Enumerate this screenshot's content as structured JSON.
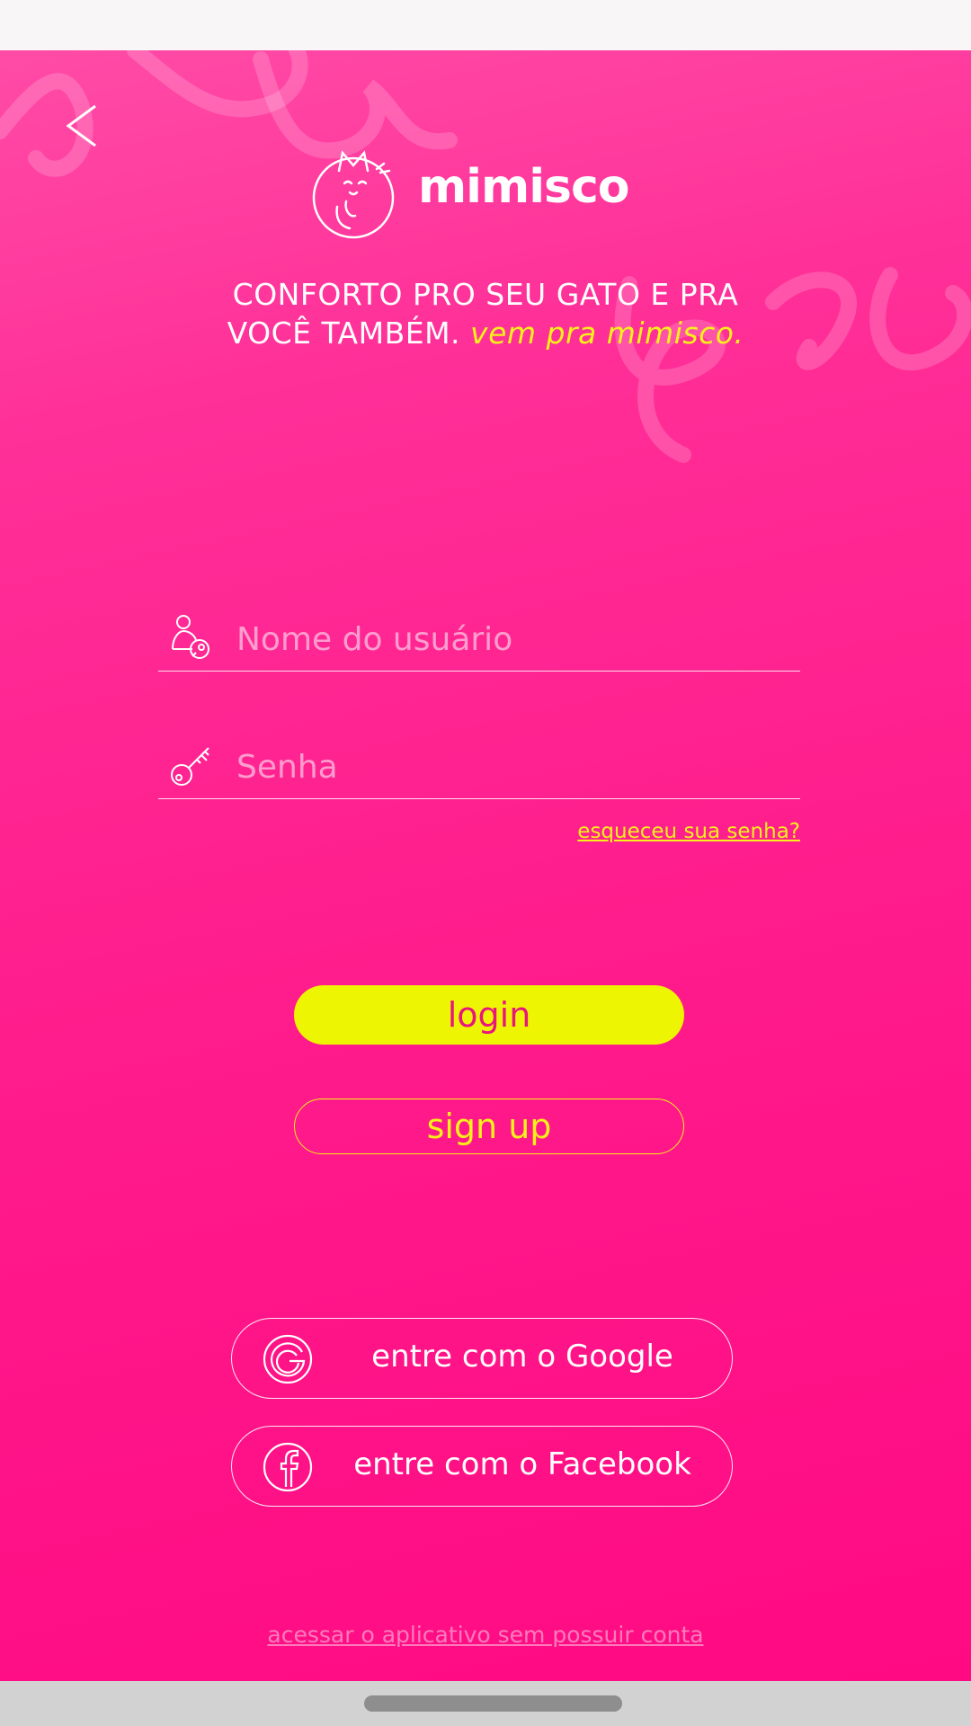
{
  "app": {
    "logo_text": "mimisco"
  },
  "tagline": {
    "line1": "CONFORTO PRO SEU GATO E PRA",
    "line2": "VOCÊ TAMBÉM.",
    "accent": "vem pra mimisco."
  },
  "form": {
    "username_placeholder": "Nome do usuário",
    "password_placeholder": "Senha",
    "forgot_password": "esqueceu sua senha?"
  },
  "actions": {
    "login_label": "login",
    "signup_label": "sign up",
    "google_label": "entre com o Google",
    "facebook_label": "entre com o Facebook",
    "guest_label": "acessar o aplicativo sem possuir conta"
  },
  "icons": {
    "back": "chevron-left-icon",
    "user": "user-key-icon",
    "password": "key-icon",
    "google": "google-icon",
    "facebook": "facebook-icon"
  },
  "colors": {
    "background_top": "#ff4ba6",
    "background_bottom": "#ff0a83",
    "accent_yellow": "#f6f11a",
    "login_button": "#eef503",
    "login_text": "#e8157f"
  }
}
